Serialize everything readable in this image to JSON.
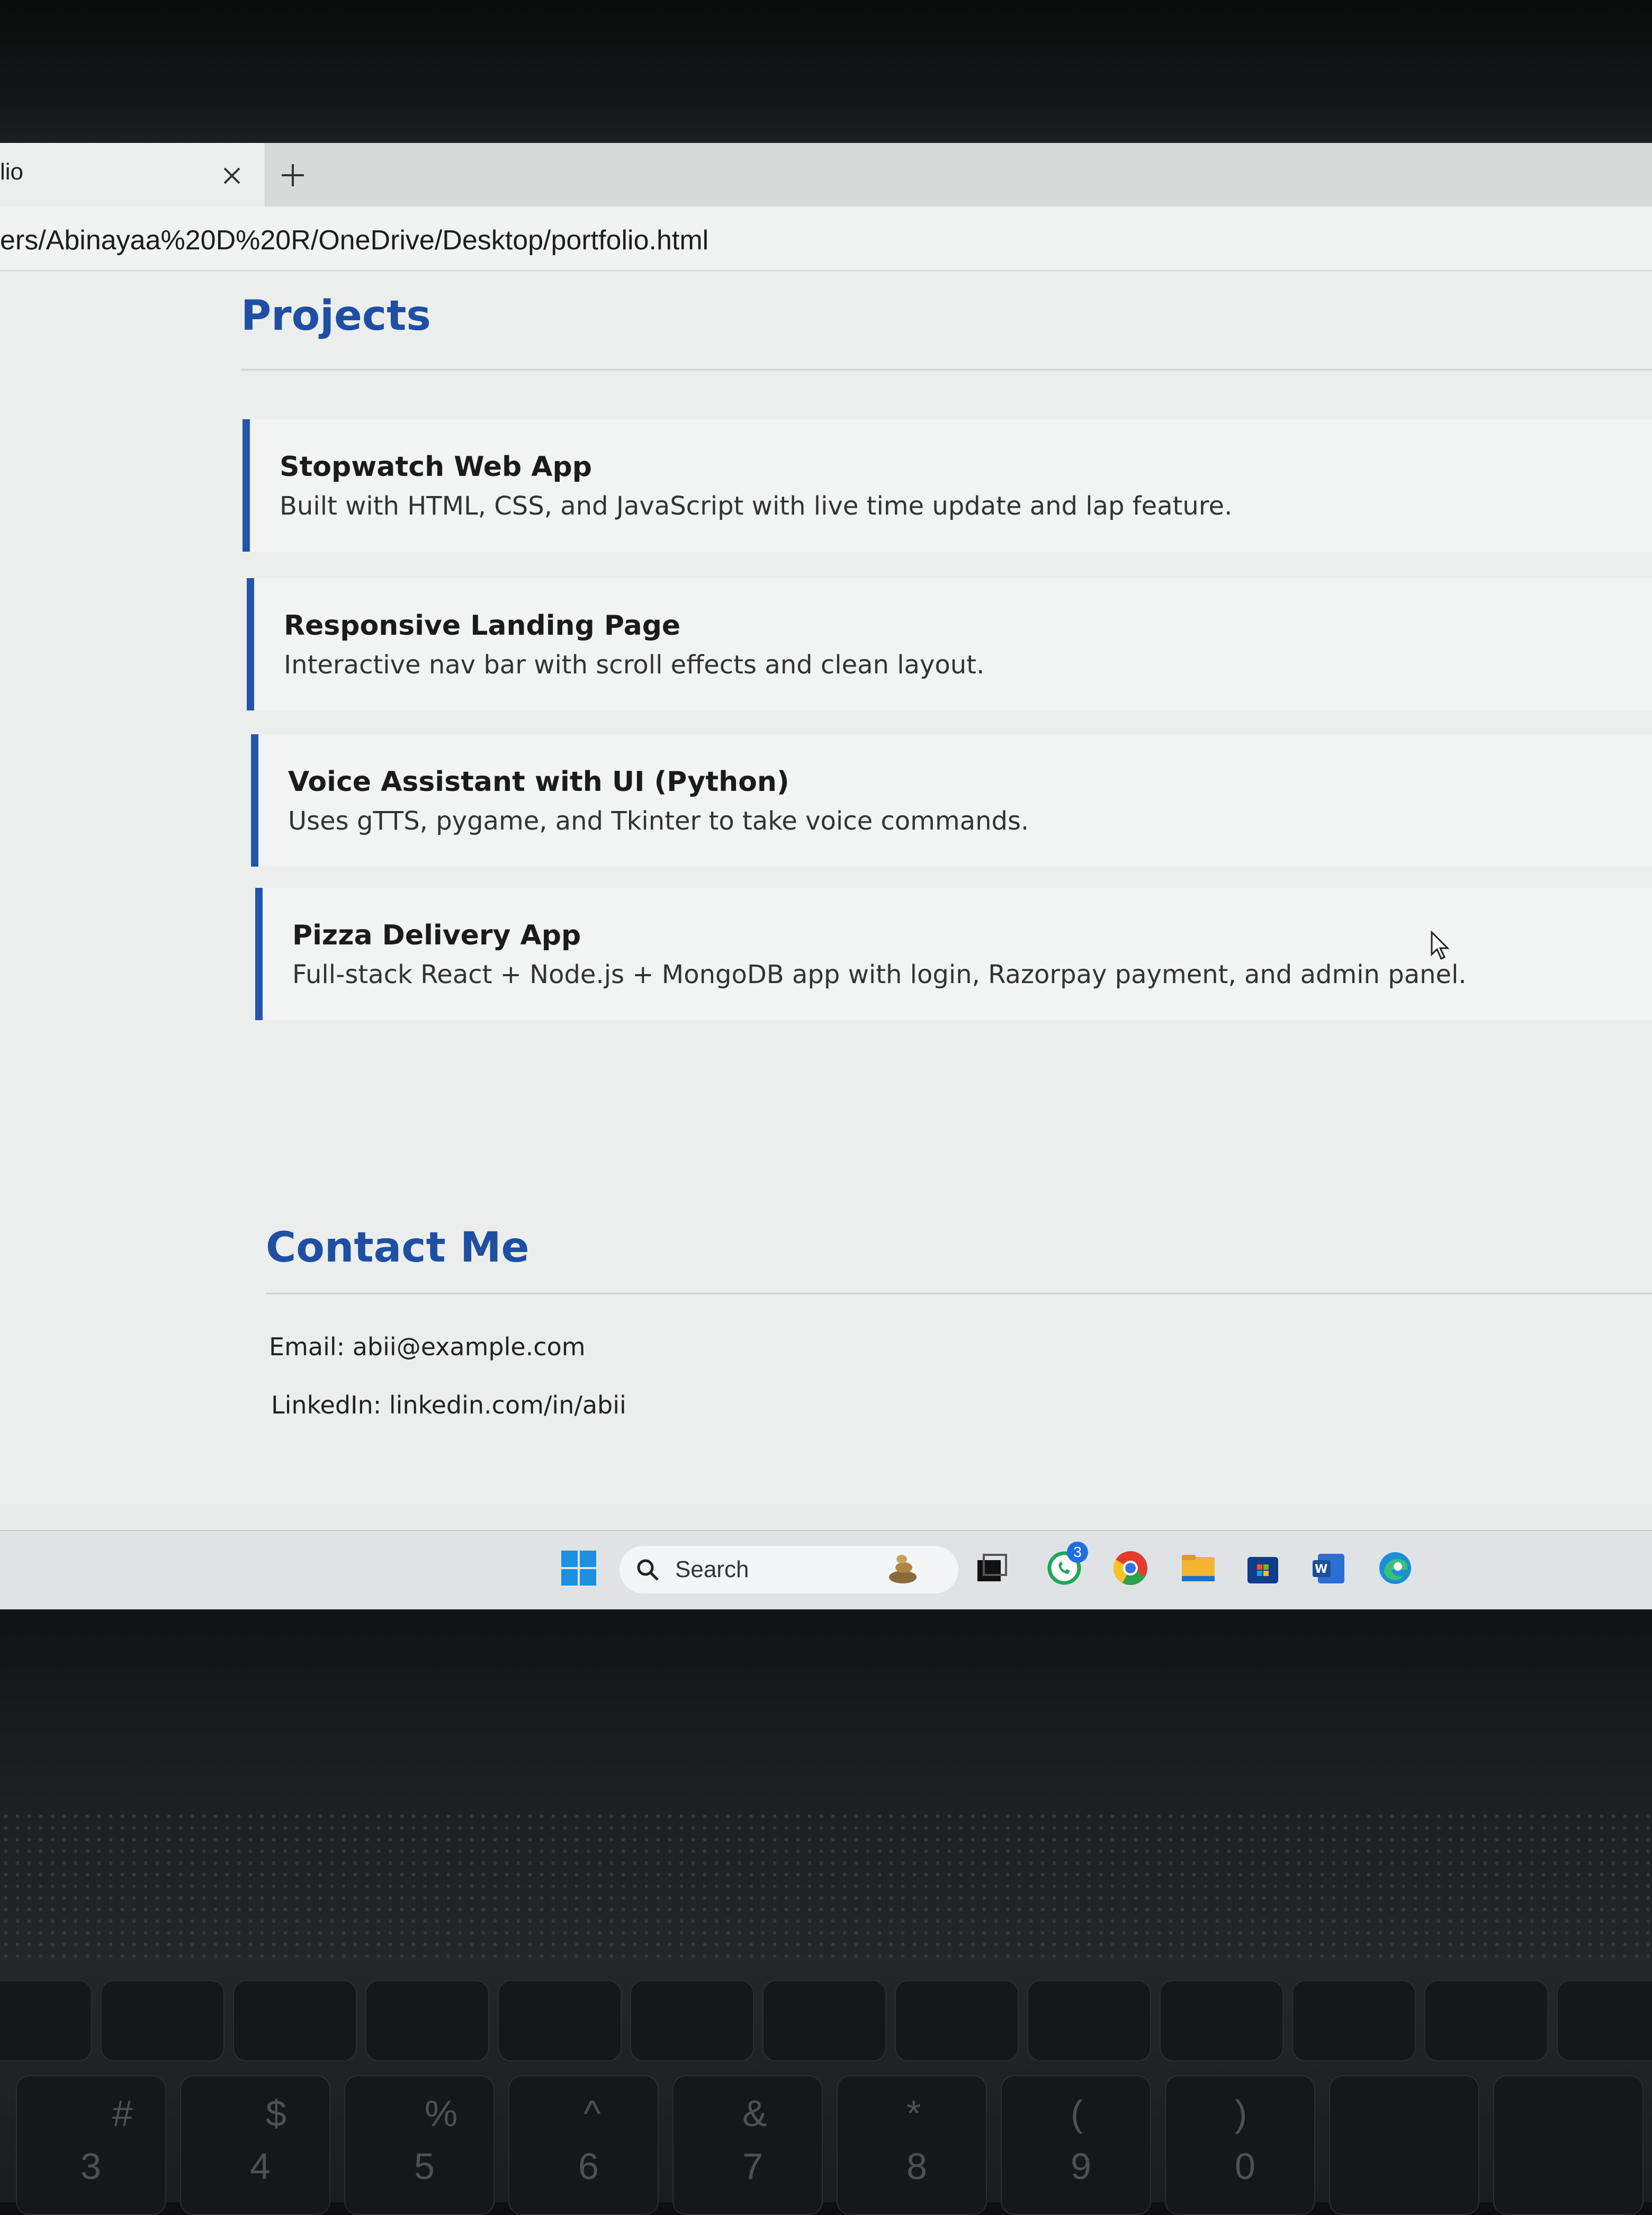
{
  "browser": {
    "tab_title": "lio",
    "address_url": "ers/Abinayaa%20D%20R/OneDrive/Desktop/portfolio.html"
  },
  "page": {
    "projects_heading": "Projects",
    "projects": [
      {
        "title": "Stopwatch Web App",
        "description": "Built with HTML, CSS, and JavaScript with live time update and lap feature."
      },
      {
        "title": "Responsive Landing Page",
        "description": "Interactive nav bar with scroll effects and clean layout."
      },
      {
        "title": "Voice Assistant with UI (Python)",
        "description": "Uses gTTS, pygame, and Tkinter to take voice commands."
      },
      {
        "title": "Pizza Delivery App",
        "description": "Full-stack React + Node.js + MongoDB app with login, Razorpay payment, and admin panel."
      }
    ],
    "contact_heading": "Contact Me",
    "contact": {
      "email": "Email: abii@example.com",
      "linkedin": "LinkedIn: linkedin.com/in/abii"
    }
  },
  "taskbar": {
    "search_label": "Search",
    "whatsapp_badge": "3",
    "icons": [
      "windows-start-icon",
      "search-icon",
      "widgets-icon",
      "task-view-icon",
      "whatsapp-icon",
      "chrome-icon",
      "file-explorer-icon",
      "microsoft-store-icon",
      "word-icon",
      "edge-icon"
    ]
  },
  "keyboard": {
    "number_keys": [
      {
        "top": "#",
        "bottom": "3"
      },
      {
        "top": "$",
        "bottom": "4"
      },
      {
        "top": "%",
        "bottom": "5"
      },
      {
        "top": "^",
        "bottom": "6"
      },
      {
        "top": "&",
        "bottom": "7"
      },
      {
        "top": "*",
        "bottom": "8"
      },
      {
        "top": "(",
        "bottom": "9"
      },
      {
        "top": ")",
        "bottom": "0"
      }
    ]
  },
  "colors": {
    "accent": "#1f4fa3",
    "project_border": "#2255aa"
  }
}
